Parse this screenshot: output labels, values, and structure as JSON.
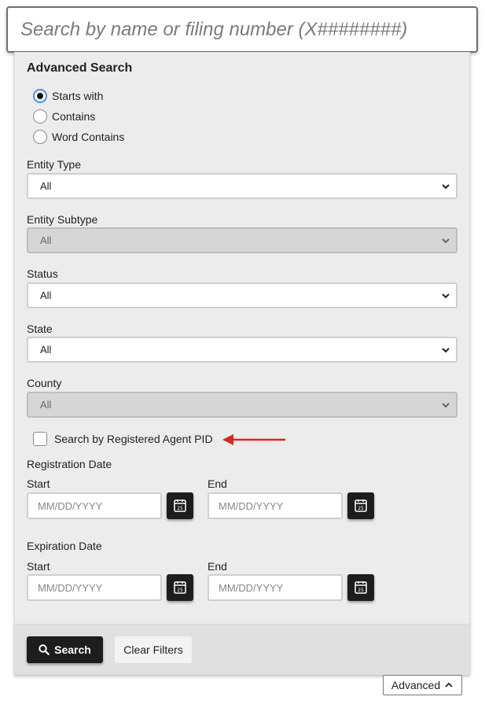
{
  "search": {
    "placeholder": "Search by name or filing number (X########)",
    "value": ""
  },
  "advanced": {
    "title": "Advanced Search",
    "match_options": [
      {
        "label": "Starts with",
        "checked": true
      },
      {
        "label": "Contains",
        "checked": false
      },
      {
        "label": "Word Contains",
        "checked": false
      }
    ],
    "entity_type": {
      "label": "Entity Type",
      "value": "All",
      "disabled": false
    },
    "entity_subtype": {
      "label": "Entity Subtype",
      "value": "All",
      "disabled": true
    },
    "status": {
      "label": "Status",
      "value": "All",
      "disabled": false
    },
    "state": {
      "label": "State",
      "value": "All",
      "disabled": false
    },
    "county": {
      "label": "County",
      "value": "All",
      "disabled": true
    },
    "registered_agent_checkbox": {
      "label": "Search by Registered Agent PID",
      "checked": false
    },
    "registration_date": {
      "title": "Registration Date",
      "start_label": "Start",
      "end_label": "End",
      "start_placeholder": "MM/DD/YYYY",
      "end_placeholder": "MM/DD/YYYY"
    },
    "expiration_date": {
      "title": "Expiration Date",
      "start_label": "Start",
      "end_label": "End",
      "start_placeholder": "MM/DD/YYYY",
      "end_placeholder": "MM/DD/YYYY"
    },
    "calendar_icon_day": "25",
    "search_button": "Search",
    "clear_button": "Clear Filters",
    "toggle_label": "Advanced"
  },
  "colors": {
    "panel_bg": "#ececec",
    "button_dark": "#1d1d1d",
    "arrow_red": "#d9261c",
    "radio_focus": "#4a90d9"
  },
  "icons": {
    "search": "search-icon",
    "calendar": "calendar-icon",
    "chevron_down": "chevron-down-icon",
    "chevron_up": "chevron-up-icon",
    "arrow": "red-arrow-annotation-icon"
  }
}
